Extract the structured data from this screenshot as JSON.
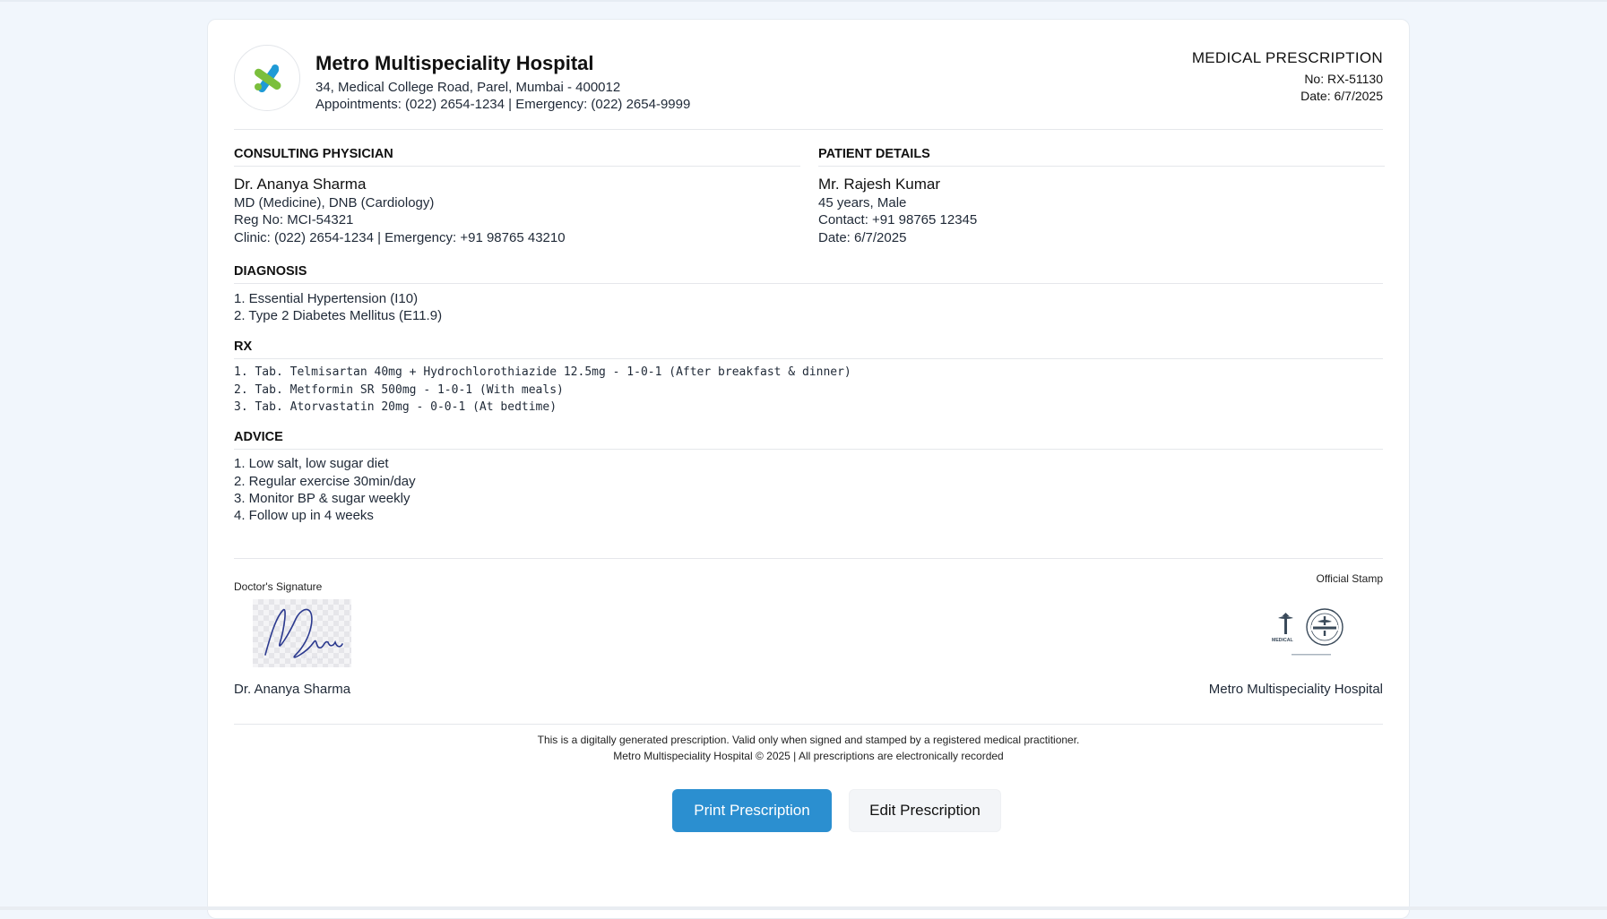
{
  "hospital": {
    "name": "Metro Multispeciality Hospital",
    "address": "34, Medical College Road, Parel, Mumbai - 400012",
    "contacts": "Appointments: (022) 2654-1234 | Emergency: (022) 2654-9999"
  },
  "prescription": {
    "title": "MEDICAL PRESCRIPTION",
    "number": "No: RX-51130",
    "date": "Date: 6/7/2025"
  },
  "physician": {
    "heading": "CONSULTING PHYSICIAN",
    "name": "Dr. Ananya Sharma",
    "qualification": "MD (Medicine), DNB (Cardiology)",
    "reg": "Reg No: MCI-54321",
    "contact": "Clinic: (022) 2654-1234 | Emergency: +91 98765 43210"
  },
  "patient": {
    "heading": "PATIENT DETAILS",
    "name": "Mr. Rajesh Kumar",
    "age_gender": "45 years, Male",
    "contact": "Contact: +91 98765 12345",
    "date": "Date: 6/7/2025"
  },
  "diagnosis": {
    "heading": "DIAGNOSIS",
    "items": [
      "1. Essential Hypertension (I10)",
      "2. Type 2 Diabetes Mellitus (E11.9)"
    ]
  },
  "rx": {
    "heading": "RX",
    "items": [
      "1. Tab. Telmisartan 40mg + Hydrochlorothiazide 12.5mg - 1-0-1 (After breakfast & dinner)",
      "2. Tab. Metformin SR 500mg - 1-0-1 (With meals)",
      "3. Tab. Atorvastatin 20mg - 0-0-1 (At bedtime)"
    ]
  },
  "advice": {
    "heading": "ADVICE",
    "items": [
      "1. Low salt, low sugar diet",
      "2. Regular exercise 30min/day",
      "3. Monitor BP & sugar weekly",
      "4. Follow up in 4 weeks"
    ]
  },
  "signature": {
    "label": "Doctor's Signature",
    "signature_text": "Dennis",
    "name": "Dr. Ananya Sharma"
  },
  "stamp": {
    "label": "Official Stamp",
    "stamp_text": "MEDICAL",
    "hospital": "Metro Multispeciality Hospital"
  },
  "footer": {
    "line1": "This is a digitally generated prescription. Valid only when signed and stamped by a registered medical practitioner.",
    "line2": "Metro Multispeciality Hospital © 2025 | All prescriptions are electronically recorded"
  },
  "buttons": {
    "print": "Print Prescription",
    "edit": "Edit Prescription"
  },
  "colors": {
    "primary": "#2b8fd0",
    "logo_blue": "#1f9ad6",
    "logo_green": "#7bbf3c",
    "signature_ink": "#2c3a8f"
  }
}
